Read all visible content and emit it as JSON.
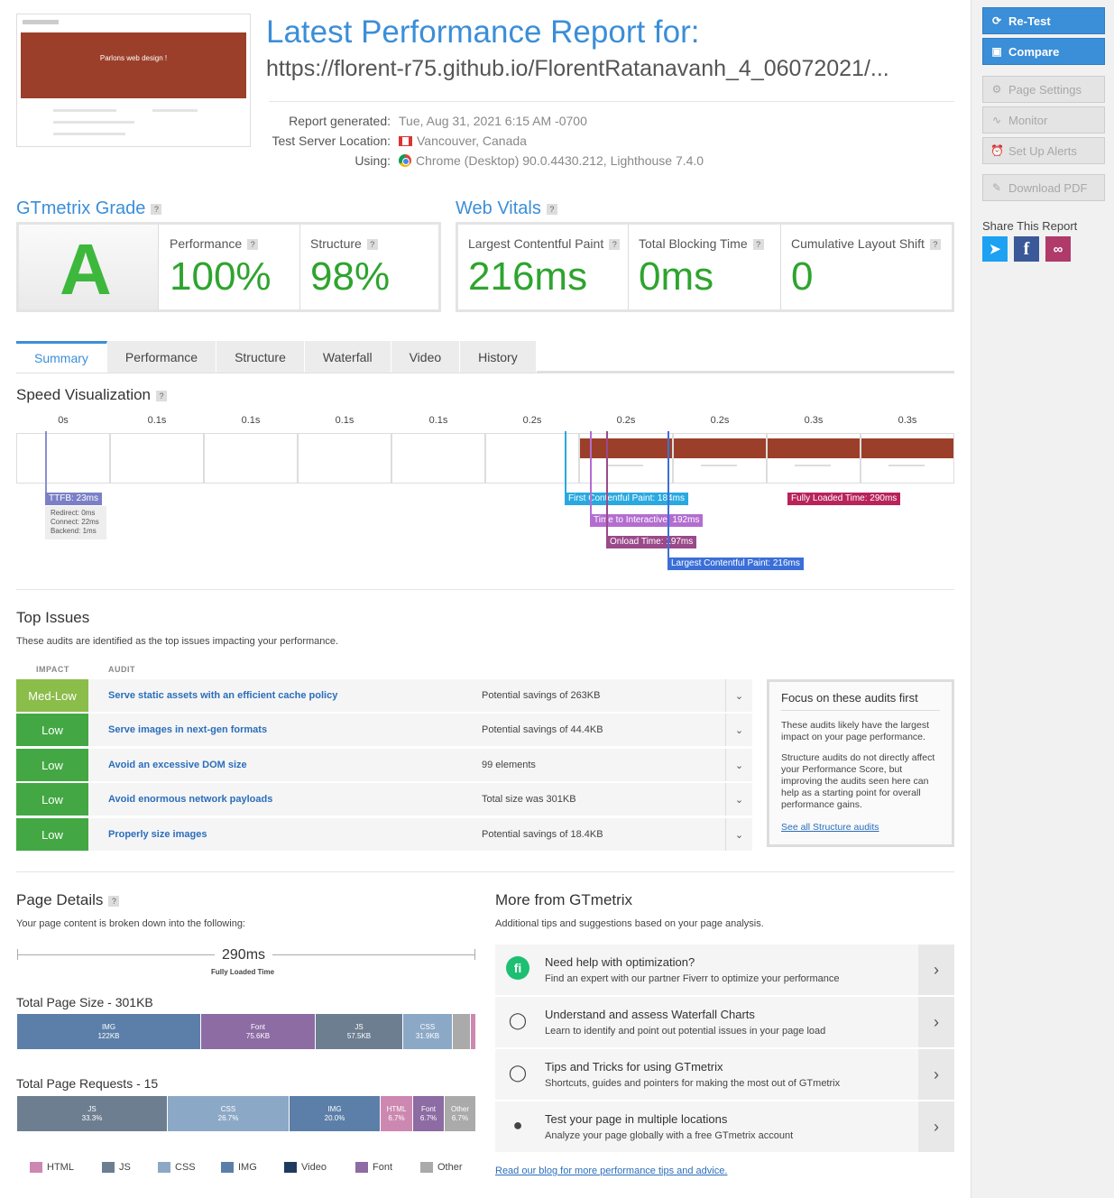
{
  "header": {
    "title": "Latest Performance Report for:",
    "url": "https://florent-r75.github.io/FlorentRatanavanh_4_06072021/...",
    "meta": [
      {
        "label": "Report generated:",
        "value": "Tue, Aug 31, 2021 6:15 AM -0700"
      },
      {
        "label": "Test Server Location:",
        "value": "Vancouver, Canada"
      },
      {
        "label": "Using:",
        "value": "Chrome (Desktop) 90.0.4430.212, Lighthouse 7.4.0"
      }
    ],
    "thumbnail_headline": "Parlons web design !"
  },
  "sidebar": {
    "retest": "Re-Test",
    "compare": "Compare",
    "page_settings": "Page Settings",
    "monitor": "Monitor",
    "alerts": "Set Up Alerts",
    "pdf": "Download PDF",
    "share_title": "Share This Report"
  },
  "grade": {
    "title": "GTmetrix Grade",
    "letter": "A",
    "performance_label": "Performance",
    "performance_value": "100%",
    "structure_label": "Structure",
    "structure_value": "98%"
  },
  "vitals": {
    "title": "Web Vitals",
    "lcp_label": "Largest Contentful Paint",
    "lcp_value": "216ms",
    "tbt_label": "Total Blocking Time",
    "tbt_value": "0ms",
    "cls_label": "Cumulative Layout Shift",
    "cls_value": "0"
  },
  "tabs": [
    "Summary",
    "Performance",
    "Structure",
    "Waterfall",
    "Video",
    "History"
  ],
  "speed": {
    "title": "Speed Visualization",
    "ticks": [
      "0s",
      "0.1s",
      "0.1s",
      "0.1s",
      "0.1s",
      "0.2s",
      "0.2s",
      "0.2s",
      "0.3s",
      "0.3s"
    ],
    "ttfb": "TTFB: 23ms",
    "ttfb_detail": [
      "Redirect: 0ms",
      "Connect: 22ms",
      "Backend: 1ms"
    ],
    "fcp": "First Contentful Paint: 184ms",
    "tti": "Time to Interactive: 192ms",
    "onload": "Onload Time: 197ms",
    "lcp": "Largest Contentful Paint: 216ms",
    "fully": "Fully Loaded Time: 290ms"
  },
  "issues": {
    "title": "Top Issues",
    "subtitle": "These audits are identified as the top issues impacting your performance.",
    "col_impact": "IMPACT",
    "col_audit": "AUDIT",
    "rows": [
      {
        "impact": "Med-Low",
        "audit": "Serve static assets with an efficient cache policy",
        "savings": "Potential savings of 263KB"
      },
      {
        "impact": "Low",
        "audit": "Serve images in next-gen formats",
        "savings": "Potential savings of 44.4KB"
      },
      {
        "impact": "Low",
        "audit": "Avoid an excessive DOM size",
        "savings": "99 elements"
      },
      {
        "impact": "Low",
        "audit": "Avoid enormous network payloads",
        "savings": "Total size was 301KB"
      },
      {
        "impact": "Low",
        "audit": "Properly size images",
        "savings": "Potential savings of 18.4KB"
      }
    ],
    "focus_title": "Focus on these audits first",
    "focus_p1": "These audits likely have the largest impact on your page performance.",
    "focus_p2": "Structure audits do not directly affect your Performance Score, but improving the audits seen here can help as a starting point for overall performance gains.",
    "focus_link": "See all Structure audits"
  },
  "details": {
    "title": "Page Details",
    "subtitle": "Your page content is broken down into the following:",
    "fully_loaded": "290ms",
    "fully_loaded_label": "Fully Loaded Time",
    "size_title": "Total Page Size - 301KB",
    "size_segments": [
      {
        "name": "IMG",
        "value": "122KB"
      },
      {
        "name": "Font",
        "value": "75.6KB"
      },
      {
        "name": "JS",
        "value": "57.5KB"
      },
      {
        "name": "CSS",
        "value": "31.9KB"
      }
    ],
    "req_title": "Total Page Requests - 15",
    "req_segments": [
      {
        "name": "JS",
        "value": "33.3%"
      },
      {
        "name": "CSS",
        "value": "26.7%"
      },
      {
        "name": "IMG",
        "value": "20.0%"
      },
      {
        "name": "HTML",
        "value": "6.7%"
      },
      {
        "name": "Font",
        "value": "6.7%"
      },
      {
        "name": "Other",
        "value": "6.7%"
      }
    ],
    "legend": [
      "HTML",
      "JS",
      "CSS",
      "IMG",
      "Video",
      "Font",
      "Other"
    ]
  },
  "more": {
    "title": "More from GTmetrix",
    "subtitle": "Additional tips and suggestions based on your page analysis.",
    "rows": [
      {
        "title": "Need help with optimization?",
        "desc": "Find an expert with our partner Fiverr to optimize your performance"
      },
      {
        "title": "Understand and assess Waterfall Charts",
        "desc": "Learn to identify and point out potential issues in your page load"
      },
      {
        "title": "Tips and Tricks for using GTmetrix",
        "desc": "Shortcuts, guides and pointers for making the most out of GTmetrix"
      },
      {
        "title": "Test your page in multiple locations",
        "desc": "Analyze your page globally with a free GTmetrix account"
      }
    ],
    "blog_link": "Read our blog for more performance tips and advice."
  },
  "colors": {
    "accent": "#3b8ed8",
    "good": "#2ea42e",
    "med_low": "#8bc34a",
    "low": "#43a843"
  }
}
